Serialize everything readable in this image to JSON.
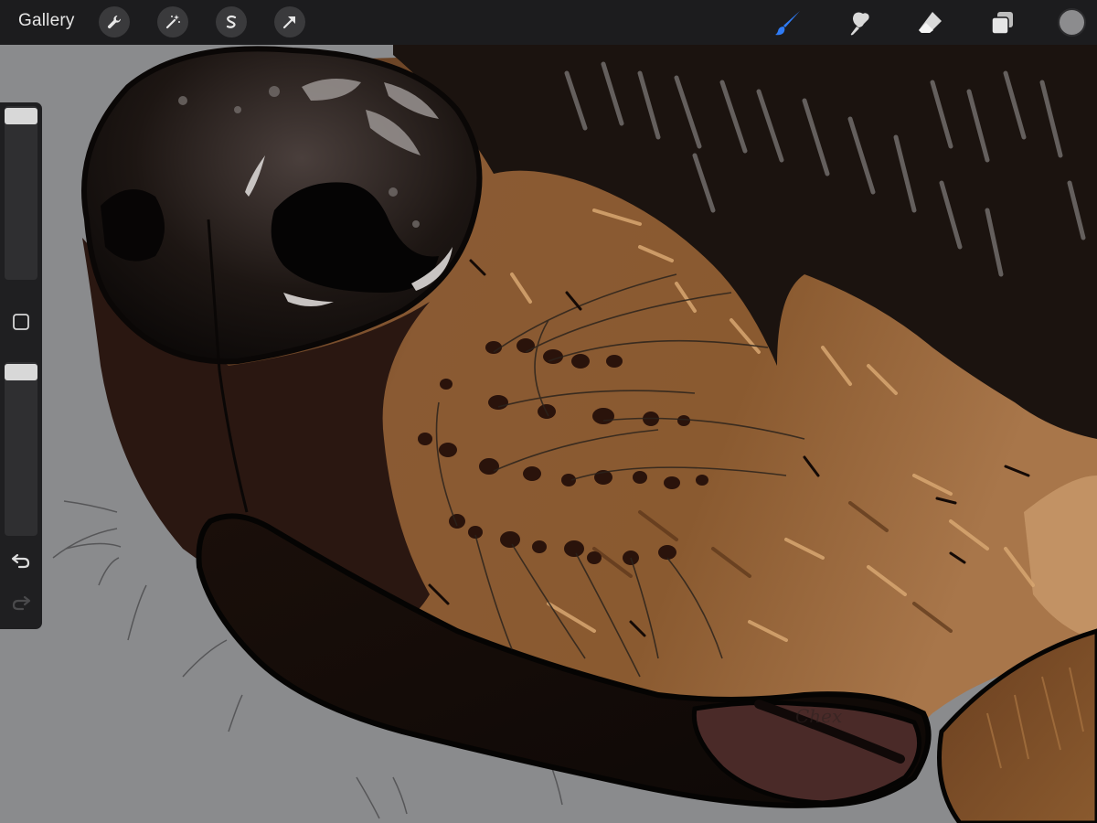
{
  "topbar": {
    "gallery_label": "Gallery",
    "left_tools": [
      "wrench-icon",
      "magic-wand-icon",
      "selection-s-icon",
      "arrow-transform-icon"
    ],
    "right_tools": [
      "brush-icon",
      "smudge-icon",
      "eraser-icon",
      "layers-icon"
    ],
    "active_tool": "brush-icon",
    "active_color": "#2f7bf5",
    "current_color": "#8c8c8e"
  },
  "sidebar": {
    "brush_size_level": 1.0,
    "opacity_level": 1.0,
    "icons": [
      "modify-square-icon",
      "undo-icon",
      "redo-icon"
    ]
  },
  "canvas": {
    "background": "#8a8b8d",
    "artwork": "dog-muzzle-illustration",
    "signature": "Chex"
  }
}
